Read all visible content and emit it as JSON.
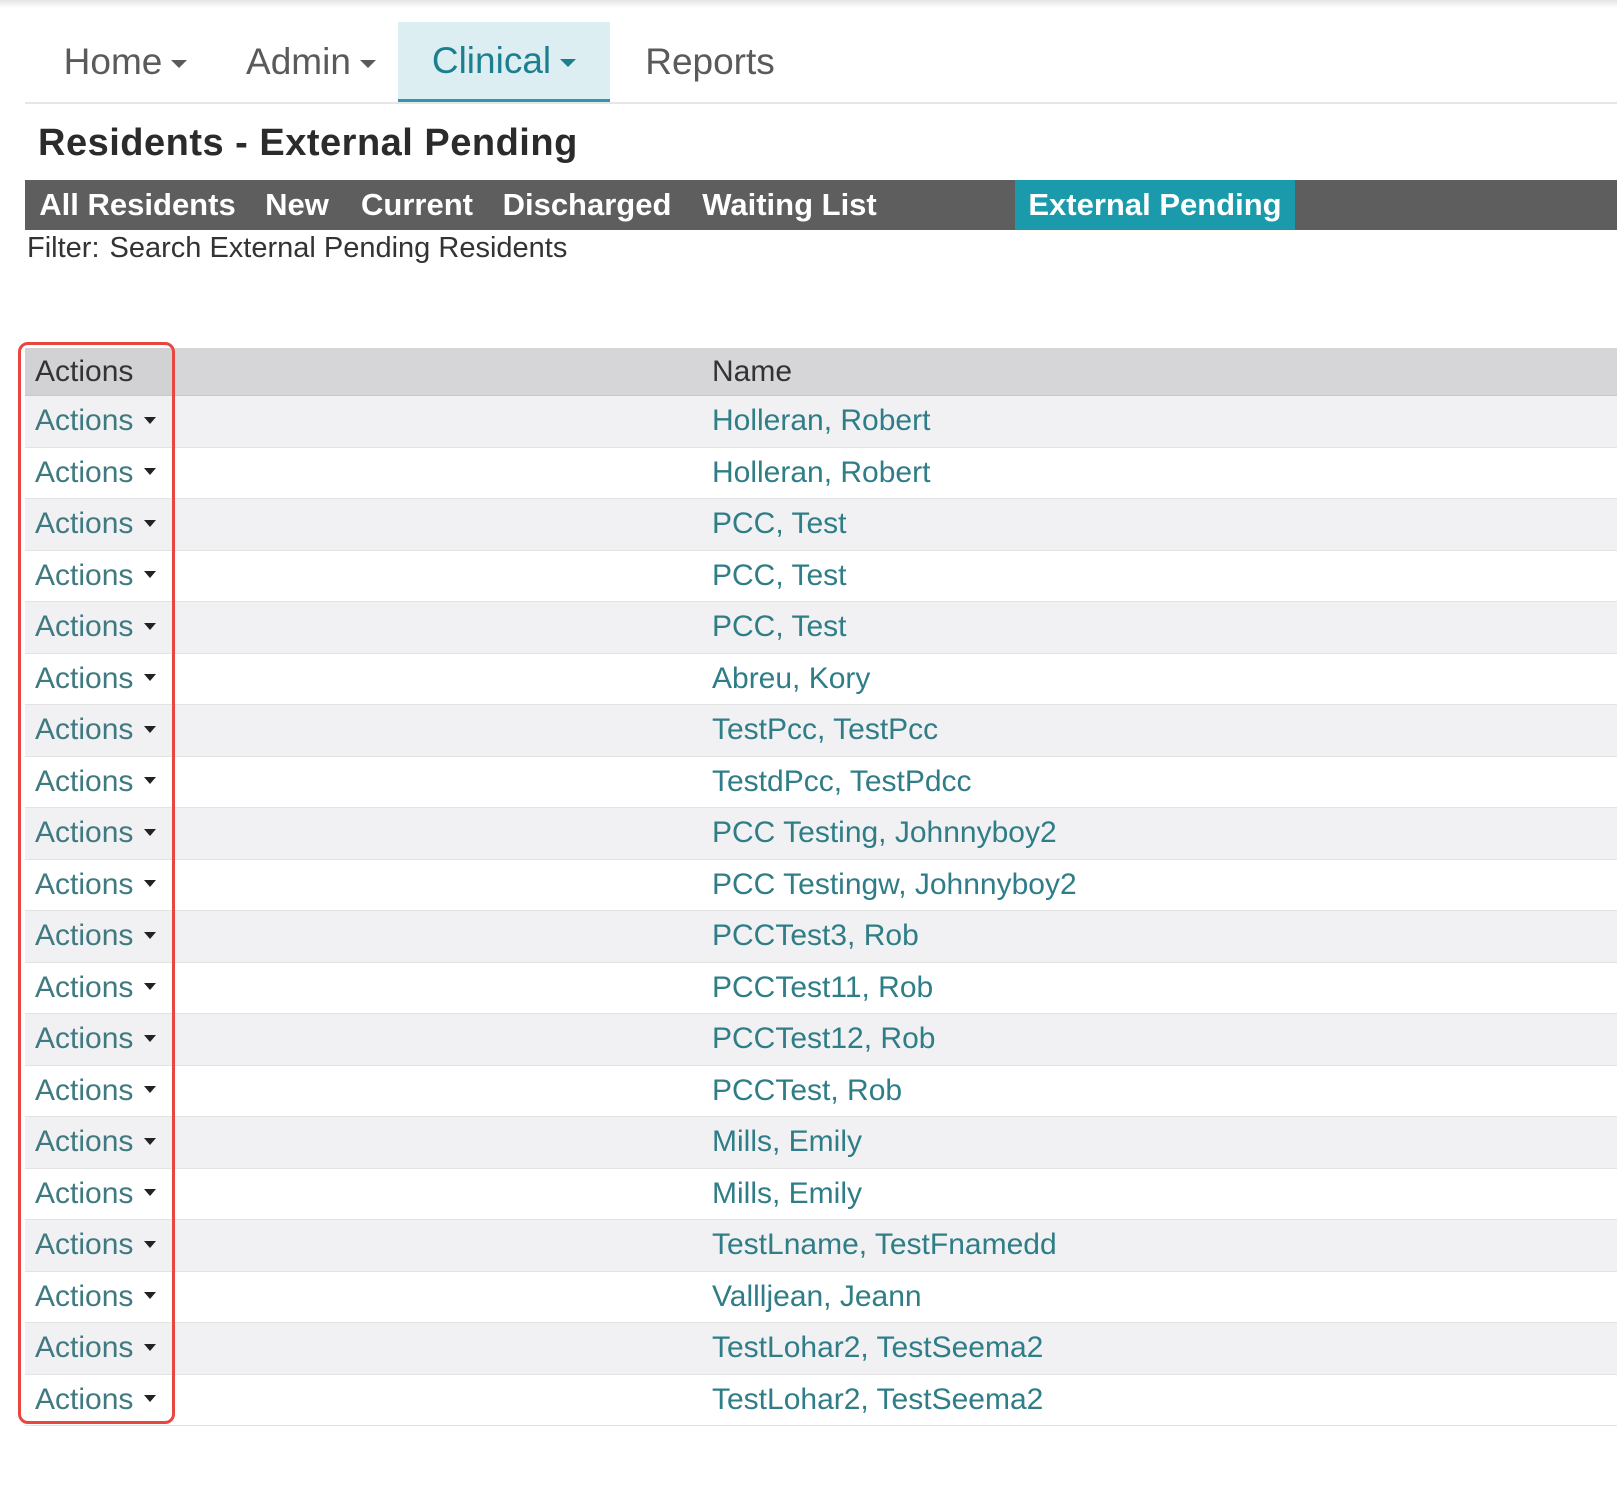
{
  "nav": {
    "items": [
      {
        "label": "Home",
        "has_caret": true,
        "active": false
      },
      {
        "label": "Admin",
        "has_caret": true,
        "active": false
      },
      {
        "label": "Clinical",
        "has_caret": true,
        "active": true
      },
      {
        "label": "Reports",
        "has_caret": false,
        "active": false
      }
    ]
  },
  "page": {
    "title": "Residents - External Pending"
  },
  "tabs": [
    {
      "label": "All Residents",
      "active": false
    },
    {
      "label": "New",
      "active": false
    },
    {
      "label": "Current",
      "active": false
    },
    {
      "label": "Discharged",
      "active": false
    },
    {
      "label": "Waiting List",
      "active": false
    },
    {
      "label": "External Pending",
      "active": true
    }
  ],
  "filter": {
    "label": "Filter:",
    "text": "Search External Pending Residents"
  },
  "table": {
    "headers": {
      "actions": "Actions",
      "name": "Name"
    },
    "action_label": "Actions",
    "rows": [
      "Holleran, Robert",
      "Holleran, Robert",
      "PCC, Test",
      "PCC, Test",
      "PCC, Test",
      "Abreu, Kory",
      "TestPcc, TestPcc",
      "TestdPcc, TestPdcc",
      "PCC Testing, Johnnyboy2",
      "PCC Testingw, Johnnyboy2",
      "PCCTest3, Rob",
      "PCCTest11, Rob",
      "PCCTest12, Rob",
      "PCCTest, Rob",
      "Mills, Emily",
      "Mills, Emily",
      "TestLname, TestFnamedd",
      "Vallljean, Jeann",
      "TestLohar2, TestSeema2",
      "TestLohar2, TestSeema2"
    ]
  },
  "colors": {
    "accent": "#1a9aaa",
    "tabbar": "#5e5e5e",
    "link": "#2f7d87",
    "highlight": "#e8473f"
  }
}
